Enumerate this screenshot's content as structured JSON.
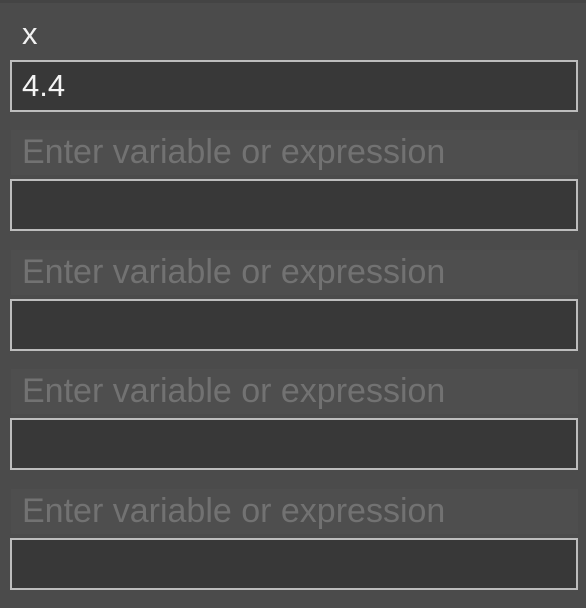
{
  "watches": [
    {
      "expression": "x",
      "value": "4.4"
    },
    {
      "expression": "",
      "placeholder": "Enter variable or expression",
      "value": ""
    },
    {
      "expression": "",
      "placeholder": "Enter variable or expression",
      "value": ""
    },
    {
      "expression": "",
      "placeholder": "Enter variable or expression",
      "value": ""
    },
    {
      "expression": "",
      "placeholder": "Enter variable or expression",
      "value": ""
    }
  ],
  "colors": {
    "panel_background": "#4b4b4b",
    "value_box_background": "#383838",
    "value_box_border": "#bdbdbd",
    "text": "#f2f2f2",
    "placeholder_text": "#727272"
  }
}
